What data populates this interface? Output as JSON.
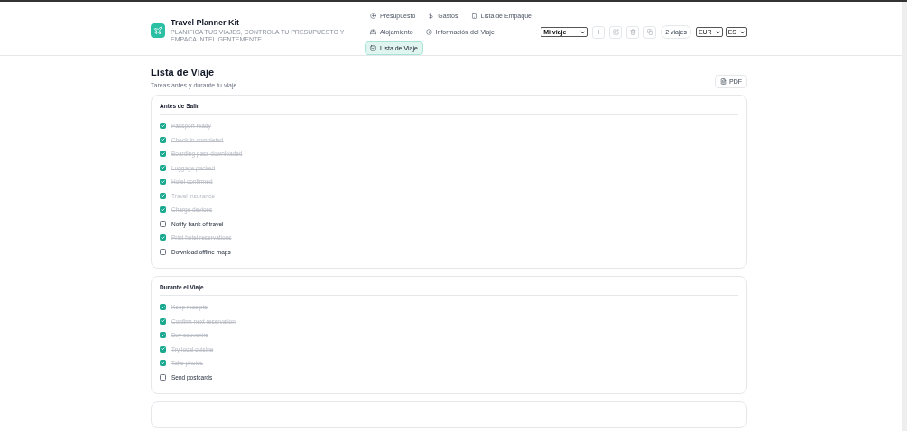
{
  "app": {
    "title": "Travel Planner Kit",
    "tagline": "PLANIFICA TUS VIAJES, CONTROLA TU PRESUPUESTO Y EMPACA INTELIGENTEMENTE."
  },
  "nav": [
    {
      "label": "Presupuesto",
      "selected": false
    },
    {
      "label": "Gastos",
      "selected": false
    },
    {
      "label": "Lista de Empaque",
      "selected": false
    },
    {
      "label": "Alojamiento",
      "selected": false
    },
    {
      "label": "Información del Viaje",
      "selected": false
    },
    {
      "label": "Lista de Viaje",
      "selected": true
    }
  ],
  "toolbar": {
    "trip_select": "Mi viaje",
    "trip_count": "2 viajes",
    "currency": "EUR",
    "language": "ES"
  },
  "page": {
    "title": "Lista de Viaje",
    "subtitle": "Tareas antes y durante tu viaje.",
    "export_button": "PDF"
  },
  "sections": [
    {
      "title": "Antes de Salir",
      "items": [
        {
          "label": "Passport ready",
          "checked": true
        },
        {
          "label": "Check-in completed",
          "checked": true
        },
        {
          "label": "Boarding pass downloaded",
          "checked": true
        },
        {
          "label": "Luggage packed",
          "checked": true
        },
        {
          "label": "Hotel confirmed",
          "checked": true
        },
        {
          "label": "Travel insurance",
          "checked": true
        },
        {
          "label": "Charge devices",
          "checked": true
        },
        {
          "label": "Notify bank of travel",
          "checked": false
        },
        {
          "label": "Print hotel reservations",
          "checked": true
        },
        {
          "label": "Download offline maps",
          "checked": false
        }
      ]
    },
    {
      "title": "Durante el Viaje",
      "items": [
        {
          "label": "Keep receipts",
          "checked": true
        },
        {
          "label": "Confirm next reservation",
          "checked": true
        },
        {
          "label": "Buy souvenirs",
          "checked": true
        },
        {
          "label": "Try local cuisine",
          "checked": true
        },
        {
          "label": "Take photos",
          "checked": true
        },
        {
          "label": "Send postcards",
          "checked": false
        }
      ]
    }
  ]
}
